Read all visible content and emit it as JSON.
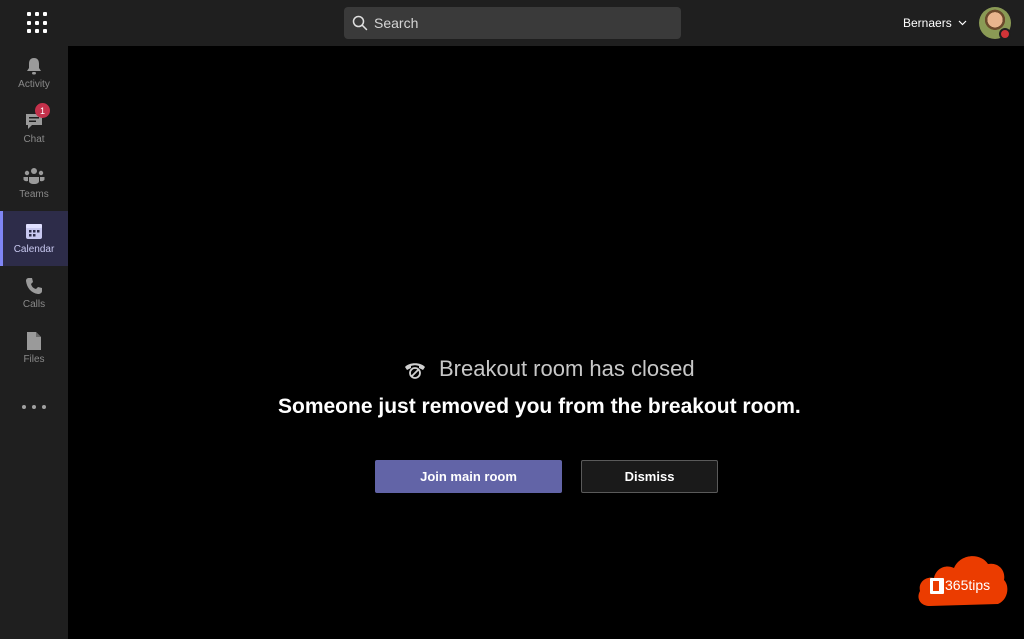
{
  "topbar": {
    "search_placeholder": "Search",
    "user_name": "Bernaers"
  },
  "rail": {
    "items": [
      {
        "label": "Activity",
        "icon": "bell-icon"
      },
      {
        "label": "Chat",
        "icon": "chat-icon",
        "badge": "1"
      },
      {
        "label": "Teams",
        "icon": "teams-icon"
      },
      {
        "label": "Calendar",
        "icon": "calendar-icon",
        "active": true
      },
      {
        "label": "Calls",
        "icon": "phone-icon"
      },
      {
        "label": "Files",
        "icon": "file-icon"
      }
    ],
    "more_icon": "ellipsis-icon"
  },
  "main": {
    "heading": "Breakout room has closed",
    "heading_icon": "hang-up-phone-icon",
    "subheading": "Someone just removed you from the breakout room.",
    "join_button": "Join main room",
    "dismiss_button": "Dismiss"
  },
  "watermark": {
    "text": "365tips"
  },
  "colors": {
    "accent": "#6264a7",
    "badge": "#c4314b",
    "logo": "#eb3c00"
  }
}
